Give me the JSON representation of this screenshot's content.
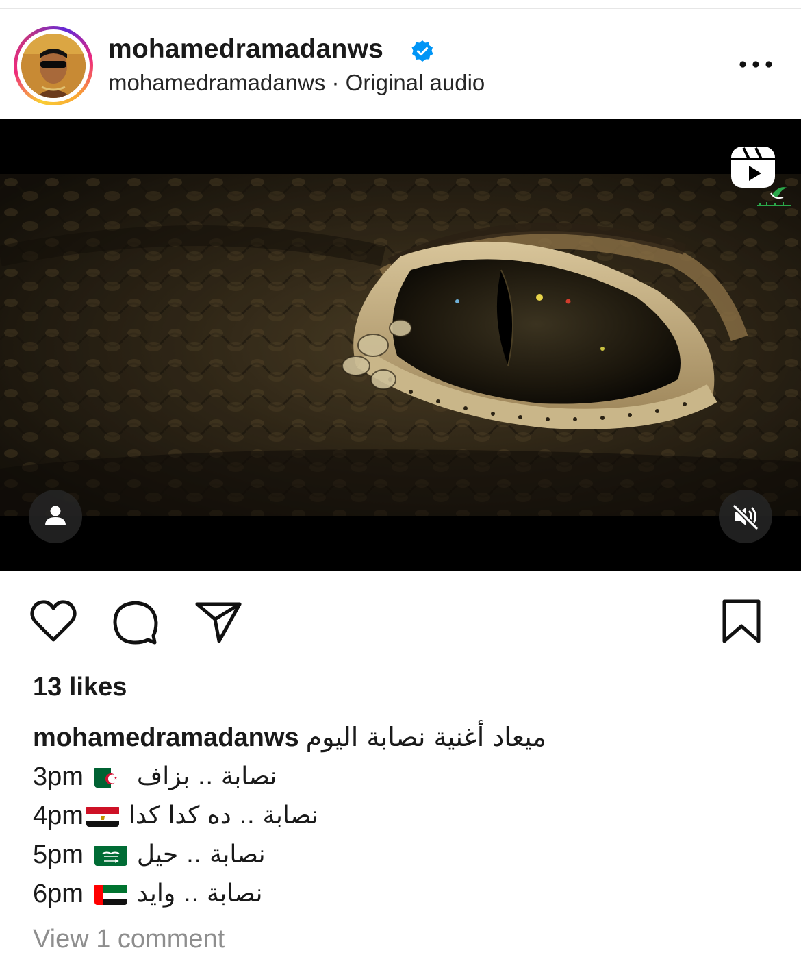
{
  "post": {
    "username": "mohamedramadanws",
    "verified": true,
    "audio_line": "mohamedramadanws · Original audio",
    "more_icon": "more-horizontal-icon"
  },
  "media": {
    "type": "reel",
    "badges": [
      "reels-icon",
      "tag-user-icon",
      "mute-icon"
    ]
  },
  "actions": {
    "icons": [
      "heart-icon",
      "comment-icon",
      "share-icon",
      "bookmark-icon"
    ],
    "likes": "13 likes"
  },
  "caption": {
    "username": "mohamedramadanws",
    "text": "ميعاد أغنية نصابة اليوم",
    "schedule": [
      {
        "time": "3pm",
        "flag": "algeria",
        "text": "نصابة .. بزاف"
      },
      {
        "time": "4pm",
        "flag": "egypt",
        "text": "نصابة .. ده كدا كدا"
      },
      {
        "time": "5pm",
        "flag": "saudi-arabia",
        "text": "نصابة .. حيل"
      },
      {
        "time": "6pm",
        "flag": "uae",
        "text": "نصابة .. وايد"
      }
    ]
  },
  "comments": {
    "view_label": "View 1 comment"
  },
  "colors": {
    "verified_blue": "#0095f6",
    "muted_gray": "#8e8e8e",
    "text": "#1a1a1a"
  }
}
